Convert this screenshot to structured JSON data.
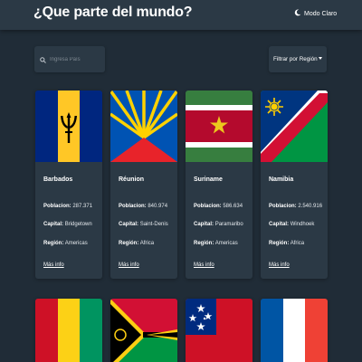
{
  "header": {
    "title": "¿Que parte del mundo?",
    "theme_toggle_label": "Modo Claro",
    "theme_icon": "moon-icon"
  },
  "search": {
    "placeholder": "Ingresa País",
    "value": "",
    "icon": "search-icon"
  },
  "filter": {
    "label": "Filtrar por Región",
    "icon": "caret-down-icon"
  },
  "labels": {
    "population": "Poblacion:",
    "capital": "Capital:",
    "region": "Región:",
    "more": "Más info"
  },
  "countries": [
    {
      "name": "Barbados",
      "population": "287.371",
      "capital": "Bridgetown",
      "region": "Americas",
      "flag": "flag-barbados"
    },
    {
      "name": "Réunion",
      "population": "840.974",
      "capital": "Saint-Denis",
      "region": "Africa",
      "flag": "flag-reunion"
    },
    {
      "name": "Suriname",
      "population": "586.634",
      "capital": "Paramaribo",
      "region": "Americas",
      "flag": "flag-suriname"
    },
    {
      "name": "Namibia",
      "population": "2.540.916",
      "capital": "Windhoek",
      "region": "Africa",
      "flag": "flag-namibia"
    }
  ],
  "partial_cards": [
    {
      "flag": "flag-guinea"
    },
    {
      "flag": "flag-vanuatu"
    },
    {
      "flag": "flag-samoa"
    },
    {
      "flag": "flag-france"
    }
  ],
  "colors": {
    "background": "#202c37",
    "surface": "#2b3945",
    "text": "#ffffff"
  }
}
